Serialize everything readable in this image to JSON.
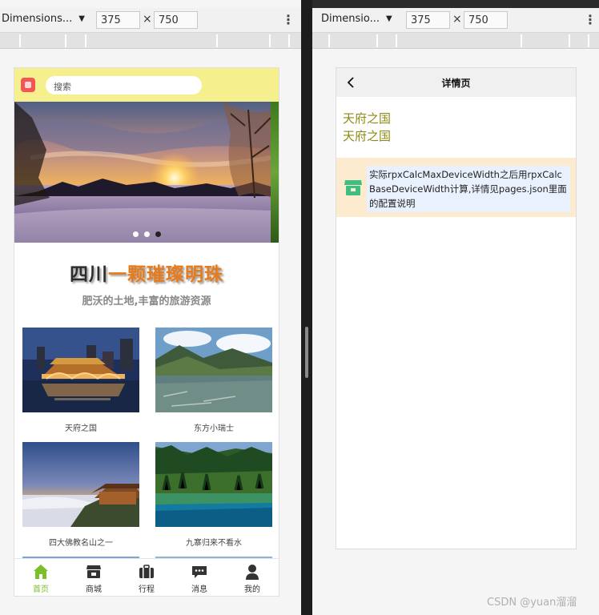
{
  "left_toolbar": {
    "device_label": "Dimensions...",
    "width_value": "375",
    "height_value": "750",
    "times_sign": "×"
  },
  "right_toolbar": {
    "device_label": "Dimensio...",
    "width_value": "375",
    "height_value": "750",
    "times_sign": "×"
  },
  "home": {
    "search_placeholder": "搜索",
    "headline_part1": "四川",
    "headline_part2": "一颗璀璨明珠",
    "subheadline": "肥沃的土地,丰富的旅游资源",
    "cards": [
      {
        "caption": "天府之国"
      },
      {
        "caption": "东方小瑞士"
      },
      {
        "caption": "四大佛教名山之一"
      },
      {
        "caption": "九寨归来不看水"
      }
    ],
    "tabs": [
      {
        "label": "首页",
        "icon": "home-icon"
      },
      {
        "label": "商城",
        "icon": "store-icon"
      },
      {
        "label": "行程",
        "icon": "briefcase-icon"
      },
      {
        "label": "消息",
        "icon": "message-icon"
      },
      {
        "label": "我的",
        "icon": "user-icon"
      }
    ],
    "active_tab_color": "#7cbf2a",
    "search_bar_color": "#f6ef8d"
  },
  "detail": {
    "nav_title": "详情页",
    "title_line1": "天府之国",
    "title_line2": "天府之国",
    "notice_text": "实际rpxCalcMaxDeviceWidth之后用rpxCalcBaseDeviceWidth计算,详情见pages.json里面的配置说明",
    "notice_bg_color": "#fdebd0",
    "title_color": "#8d8a12"
  },
  "watermark": "CSDN @yuan溜溜"
}
